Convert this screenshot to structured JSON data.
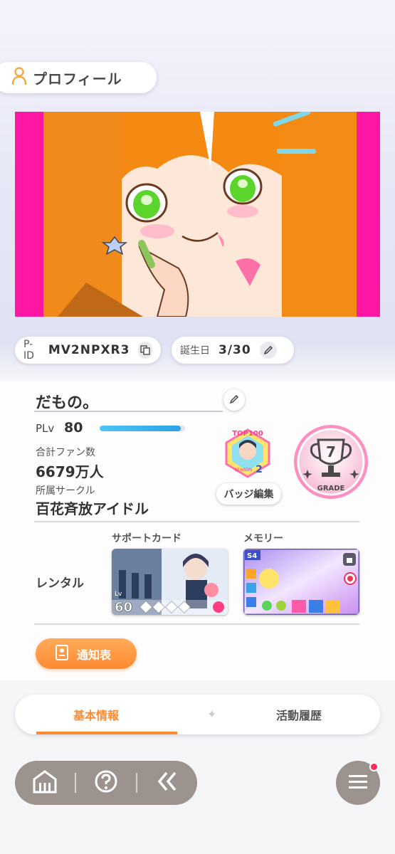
{
  "header": {
    "title": "プロフィール",
    "icon": "person-icon"
  },
  "info": {
    "pid_label": "P-ID",
    "pid_value": "MV2NPXR3",
    "birthday_label": "誕生日",
    "birthday_value": "3/30"
  },
  "profile": {
    "name": "だもの。",
    "plv_label": "PLv",
    "plv_value": "80",
    "plv_progress": 0.95,
    "fans_label": "合計ファン数",
    "fans_value": "6679万人",
    "circle_label": "所属サークル",
    "circle_value": "百花斉放アイドル",
    "badge_edit_label": "バッジ編集",
    "badge_text_top": "TOP100",
    "badge_text_season": "SEASON",
    "badge_text_num": "2",
    "grade_value": "7",
    "grade_label": "GRADE"
  },
  "rental": {
    "label": "レンタル",
    "support_label": "サポートカード",
    "memory_label": "メモリー",
    "support_lv_prefix": "Lv",
    "support_lv": "60",
    "memory_tag": "S4"
  },
  "actions": {
    "notice_label": "通知表"
  },
  "tabs": [
    {
      "label": "基本情報",
      "active": true
    },
    {
      "label": "活動履歴",
      "active": false
    }
  ],
  "colors": {
    "accent": "#ff8a32",
    "nav_bg": "#9c928e",
    "banner_bg": "#ff1aa6",
    "plv_bar": "#2aa3e8"
  }
}
